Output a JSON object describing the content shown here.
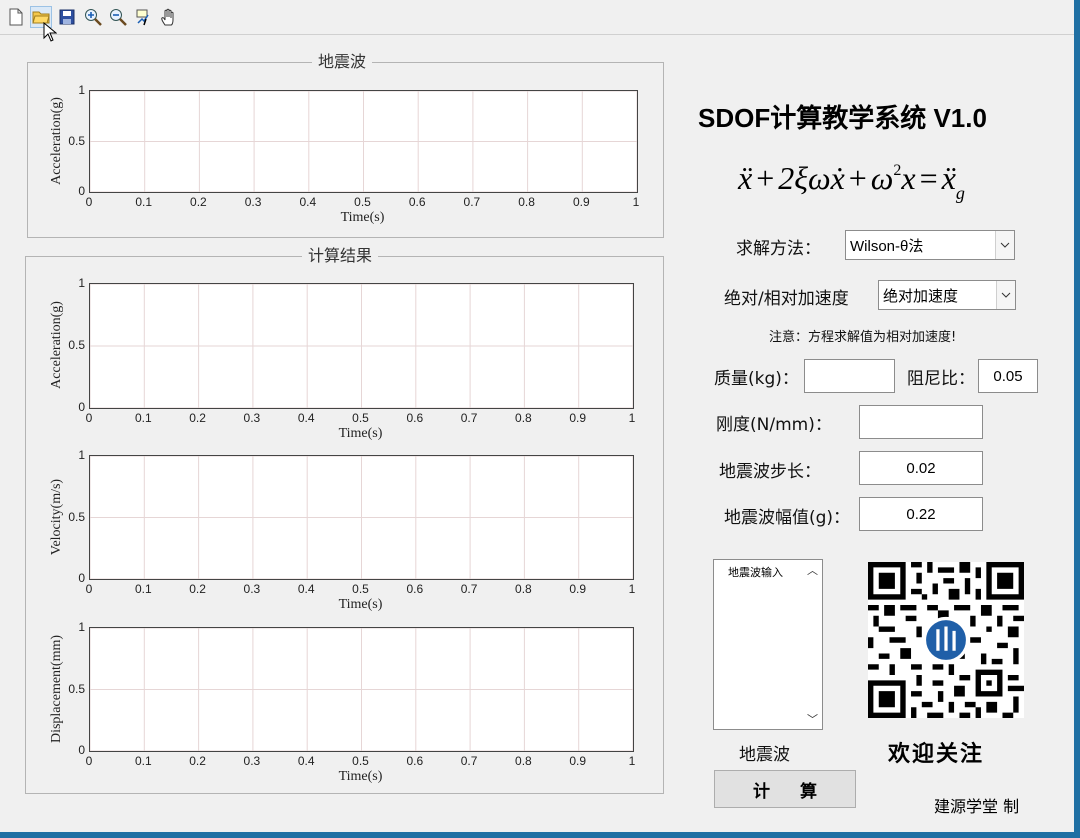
{
  "toolbar": {
    "buttons": [
      {
        "icon": "new-file-icon"
      },
      {
        "icon": "open-folder-icon"
      },
      {
        "icon": "save-icon"
      },
      {
        "icon": "zoom-in-icon"
      },
      {
        "icon": "zoom-out-icon"
      },
      {
        "icon": "data-cursor-icon"
      },
      {
        "icon": "pan-hand-icon"
      }
    ]
  },
  "panels": {
    "seismic": {
      "title": "地震波"
    },
    "results": {
      "title": "计算结果"
    }
  },
  "chart_data": [
    {
      "type": "line",
      "panel": "地震波",
      "xlabel": "Time(s)",
      "ylabel": "Acceleration(g)",
      "xlim": [
        0,
        1
      ],
      "ylim": [
        0,
        1
      ],
      "grid": true,
      "series": [],
      "xticks": [
        "0",
        "0.1",
        "0.2",
        "0.3",
        "0.4",
        "0.5",
        "0.6",
        "0.7",
        "0.8",
        "0.9",
        "1"
      ],
      "yticks": [
        "0",
        "0.5",
        "1"
      ]
    },
    {
      "type": "line",
      "panel": "计算结果",
      "xlabel": "Time(s)",
      "ylabel": "Acceleration(g)",
      "xlim": [
        0,
        1
      ],
      "ylim": [
        0,
        1
      ],
      "grid": true,
      "series": [],
      "xticks": [
        "0",
        "0.1",
        "0.2",
        "0.3",
        "0.4",
        "0.5",
        "0.6",
        "0.7",
        "0.8",
        "0.9",
        "1"
      ],
      "yticks": [
        "0",
        "0.5",
        "1"
      ]
    },
    {
      "type": "line",
      "panel": "计算结果",
      "xlabel": "Time(s)",
      "ylabel": "Velocity(m/s)",
      "xlim": [
        0,
        1
      ],
      "ylim": [
        0,
        1
      ],
      "grid": true,
      "series": [],
      "xticks": [
        "0",
        "0.1",
        "0.2",
        "0.3",
        "0.4",
        "0.5",
        "0.6",
        "0.7",
        "0.8",
        "0.9",
        "1"
      ],
      "yticks": [
        "0",
        "0.5",
        "1"
      ]
    },
    {
      "type": "line",
      "panel": "计算结果",
      "xlabel": "Time(s)",
      "ylabel": "Displacement(mm)",
      "xlim": [
        0,
        1
      ],
      "ylim": [
        0,
        1
      ],
      "grid": true,
      "series": [],
      "xticks": [
        "0",
        "0.1",
        "0.2",
        "0.3",
        "0.4",
        "0.5",
        "0.6",
        "0.7",
        "0.8",
        "0.9",
        "1"
      ],
      "yticks": [
        "0",
        "0.5",
        "1"
      ]
    }
  ],
  "app": {
    "title": "SDOF计算教学系统 V1.0",
    "equation": "ẍ + 2ξωẋ + ω²x = ẍg"
  },
  "form": {
    "method_label": "求解方法：",
    "method_value": "Wilson-θ法",
    "accel_type_label": "绝对/相对加速度",
    "accel_type_value": "绝对加速度",
    "note": "注意：方程求解值为相对加速度!",
    "mass_label": "质量(kg)：",
    "mass_value": "",
    "damping_label": "阻尼比：",
    "damping_value": "0.05",
    "stiffness_label": "刚度(N/mm)：",
    "stiffness_value": "",
    "step_label": "地震波步长：",
    "step_value": "0.02",
    "amplitude_label": "地震波幅值(g)：",
    "amplitude_value": "0.22"
  },
  "wave_list": {
    "items": [
      "地震波输入"
    ],
    "caption": "地震波"
  },
  "calc_button": "计 算",
  "qr_caption": "欢迎关注",
  "credit": "建源学堂 制",
  "colors": {
    "window_border": "#1f6fa3",
    "grid": "#e6d6d6",
    "background": "#f0f0f0"
  }
}
